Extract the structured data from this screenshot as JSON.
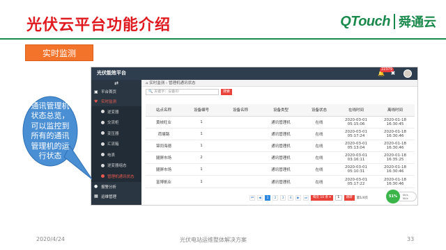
{
  "slide": {
    "title": "光伏云平台功能介绍",
    "logo_latin": "QTouch",
    "logo_cn": "舜通云",
    "section_badge": "实时监测",
    "callout": "通讯管理机状态总览，可以监控到所有的通讯管理机的运行状态",
    "footer_date": "2020/4/24",
    "footer_title": "光伏电站运维整体解决方案",
    "footer_page": "33"
  },
  "app": {
    "brand": "光伏能效平台",
    "notification_count": "22379",
    "sidebar": {
      "toggle_icon": "menu-toggle-icon",
      "items": [
        {
          "label": "平台首页",
          "icon": "monitor-icon"
        },
        {
          "label": "实时监测",
          "icon": "heart-icon"
        }
      ],
      "sub_items": [
        {
          "label": "逆变器",
          "active": false
        },
        {
          "label": "交流柜",
          "active": false
        },
        {
          "label": "变压器",
          "active": false
        },
        {
          "label": "汇流箱",
          "active": false
        },
        {
          "label": "电表",
          "active": false
        },
        {
          "label": "逆变器组态",
          "active": false
        },
        {
          "label": "管理机通讯状态",
          "active": true
        }
      ],
      "bottom_items": [
        {
          "label": "报警分析",
          "icon": "user-icon"
        },
        {
          "label": "运维管理",
          "icon": "calendar-icon"
        }
      ]
    },
    "breadcrumb": {
      "home": "实时监测",
      "separator": "›",
      "current": "管理机通讯状态"
    },
    "search": {
      "placeholder": "关键字：设备ID",
      "button": "搜索"
    },
    "table": {
      "columns": [
        "站点名称",
        "设备编号",
        "设备名称",
        "设备类型",
        "设备状态",
        "在线时间",
        "离线时间"
      ],
      "rows": [
        [
          "黄岐旺业",
          "1",
          "",
          "通讯管理机",
          "在线",
          "2020-03-01 05:15:06",
          "2020-01-18 16:30:45"
        ],
        [
          "荷塘路",
          "1",
          "",
          "通讯管理机",
          "在线",
          "2020-03-01 05:17:24",
          "2020-01-18 16:30:46"
        ],
        [
          "锦同海德",
          "1",
          "",
          "通讯管理机",
          "在线",
          "2020-03-01 05:13:04",
          "2020-01-18 16:30:46"
        ],
        [
          "腿屏市场",
          "2",
          "",
          "通讯管理机",
          "在线",
          "2020-03-01 03:16:11",
          "2020-01-18 16:35:25"
        ],
        [
          "腿屏市场",
          "1",
          "",
          "通讯管理机",
          "在线",
          "2020-03-01 05:10:31",
          "2020-01-18 16:30:46"
        ],
        [
          "富博帆业",
          "1",
          "",
          "通讯管理机",
          "在线",
          "2020-03-01 05:17:22",
          "2020-01-18 16:30:46"
        ]
      ]
    },
    "pager": {
      "first": "⏮",
      "prev": "◀",
      "pages": [
        "1",
        "2",
        "3",
        "4"
      ],
      "current_page": "1",
      "next": "▶",
      "last": "⏭",
      "page_size": "每页 10 条 ▾",
      "jump_value": "1",
      "go": "跳转",
      "total": "第1/4页"
    },
    "network_widget": {
      "percent": "51%",
      "up": "0K/s",
      "down": "0K/s"
    }
  },
  "colors": {
    "title_red": "#e0191f",
    "brand_green": "#1a8a4c",
    "badge_orange": "#f4732a",
    "sidebar_dark": "#2a3642",
    "header_dark": "#2e3e4e",
    "accent_red": "#e8423a",
    "callout_blue": "#4a8ed3"
  }
}
